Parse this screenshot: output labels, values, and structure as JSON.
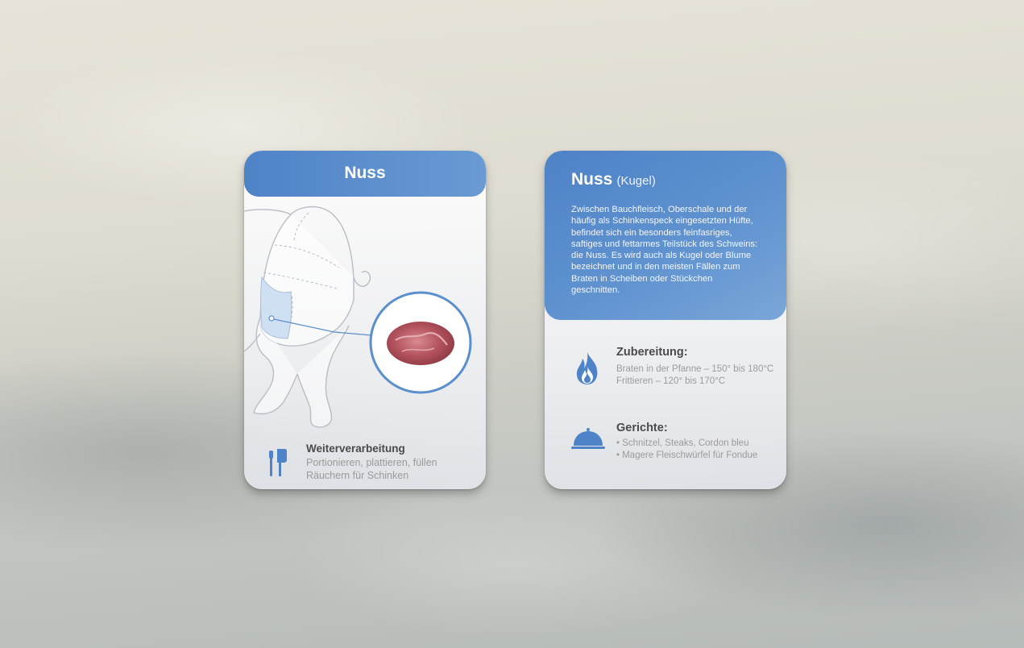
{
  "card_front": {
    "title": "Nuss",
    "processing": {
      "title": "Weiterverarbeitung",
      "lines": [
        "Portionieren, plattieren, füllen",
        "Räuchern für Schinken"
      ]
    },
    "icons": [
      "pig-leg-diagram",
      "meat-photo",
      "cleaver-knife-icon"
    ]
  },
  "card_back": {
    "title": "Nuss",
    "subtitle": "(Kugel)",
    "description_lines": [
      "Zwischen Bauchfleisch, Oberschale und der",
      "häufig als Schinkenspeck eingesetzten Hüfte,",
      "befindet sich ein besonders feinfasriges,",
      "saftiges und fettarmes Teilstück des Schweins:",
      "die Nuss. Es wird auch als Kugel oder Blume",
      "bezeichnet und in den meisten Fällen zum",
      "Braten in Scheiben oder Stückchen",
      "geschnitten."
    ],
    "preparation": {
      "title": "Zubereitung:",
      "lines": [
        "Braten in der Pfanne – 150° bis 180°C",
        "Frittieren – 120° bis 170°C"
      ]
    },
    "dishes": {
      "title": "Gerichte:",
      "lines": [
        "• Schnitzel, Steaks, Cordon bleu",
        "• Magere Fleischwürfel für Fondue"
      ]
    }
  },
  "colors": {
    "accent_blue": "#5a8ecd",
    "text_dark": "#4a4a4a",
    "text_muted": "#9a9a9a"
  }
}
